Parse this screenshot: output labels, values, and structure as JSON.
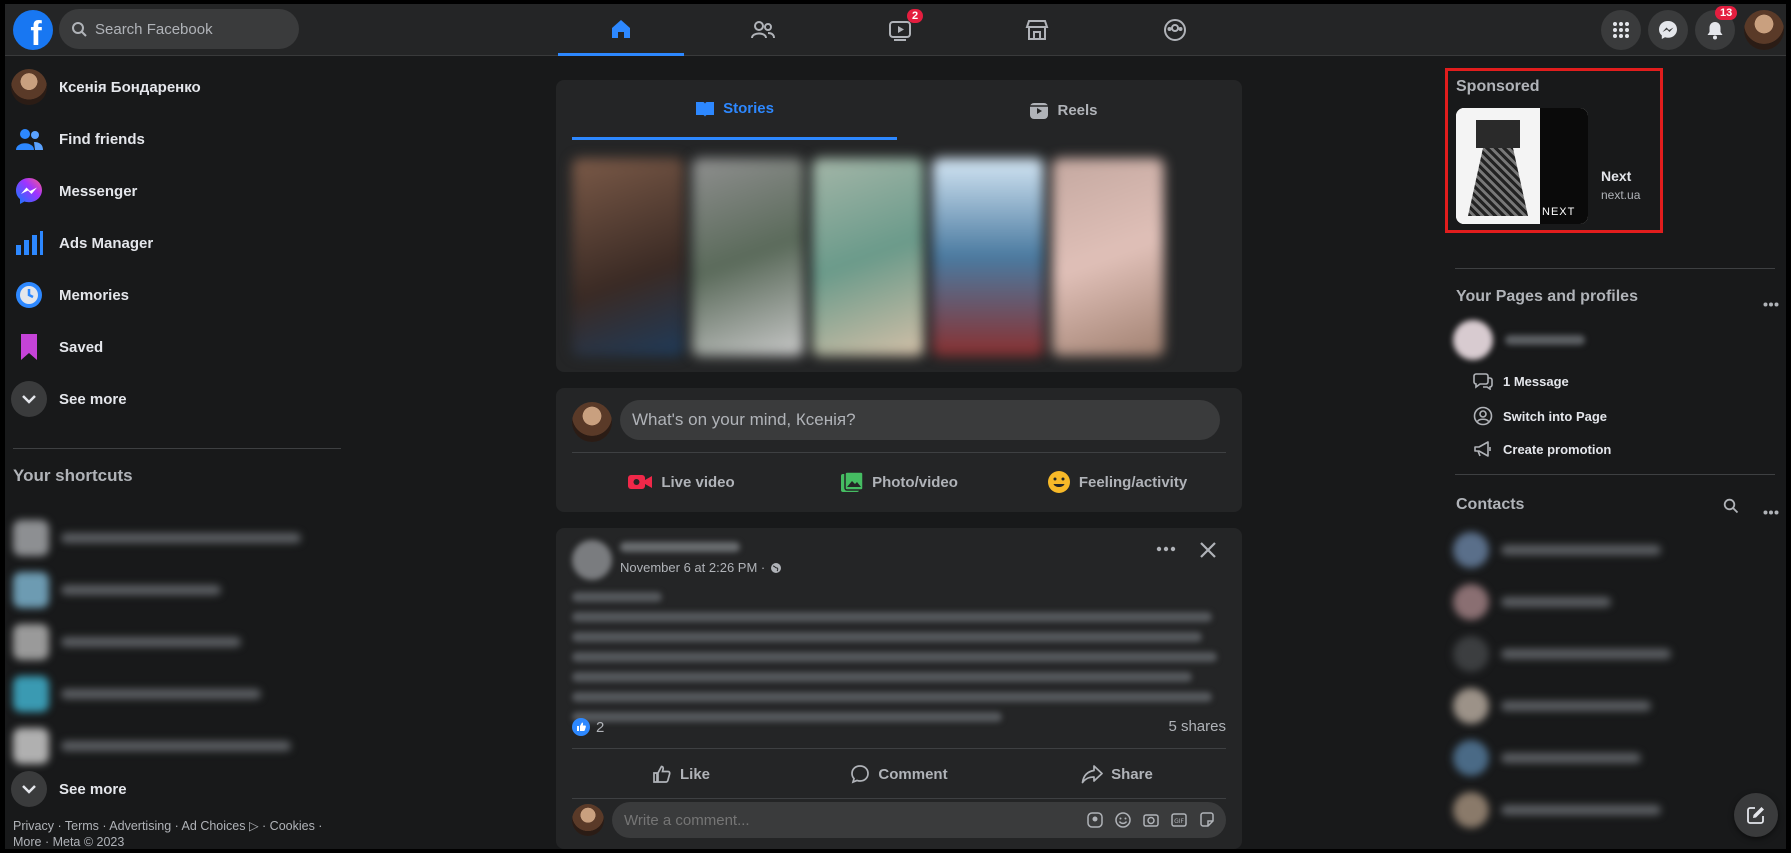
{
  "search": {
    "placeholder": "Search Facebook"
  },
  "nav": {
    "watch_badge": "2",
    "notifications_badge": "13"
  },
  "left": {
    "user_name": "Ксенія Бондаренко",
    "items": [
      {
        "label": "Find friends"
      },
      {
        "label": "Messenger"
      },
      {
        "label": "Ads Manager"
      },
      {
        "label": "Memories"
      },
      {
        "label": "Saved"
      },
      {
        "label": "See more"
      }
    ],
    "shortcuts_title": "Your shortcuts",
    "shortcuts_see_more": "See more",
    "footer": "Privacy · Terms · Advertising · Ad Choices ▷ · Cookies · More · Meta © 2023"
  },
  "stories": {
    "tab_stories": "Stories",
    "tab_reels": "Reels"
  },
  "composer": {
    "placeholder": "What's on your mind, Ксенія?",
    "live_video": "Live video",
    "photo_video": "Photo/video",
    "feeling": "Feeling/activity"
  },
  "post": {
    "timestamp": "November 6 at 2:26 PM ·",
    "likes": "2",
    "shares": "5 shares",
    "like": "Like",
    "comment": "Comment",
    "share": "Share",
    "comment_placeholder": "Write a comment..."
  },
  "right": {
    "sponsored_title": "Sponsored",
    "ad_name": "Next",
    "ad_url": "next.ua",
    "ad_brand": "NEXT",
    "pages_title": "Your Pages and profiles",
    "page_actions": [
      {
        "label": "1 Message"
      },
      {
        "label": "Switch into Page"
      },
      {
        "label": "Create promotion"
      }
    ],
    "contacts_title": "Contacts"
  },
  "colors": {
    "accent": "#2d88ff",
    "badge": "#e41e3f",
    "highlight": "#e11d1d"
  }
}
